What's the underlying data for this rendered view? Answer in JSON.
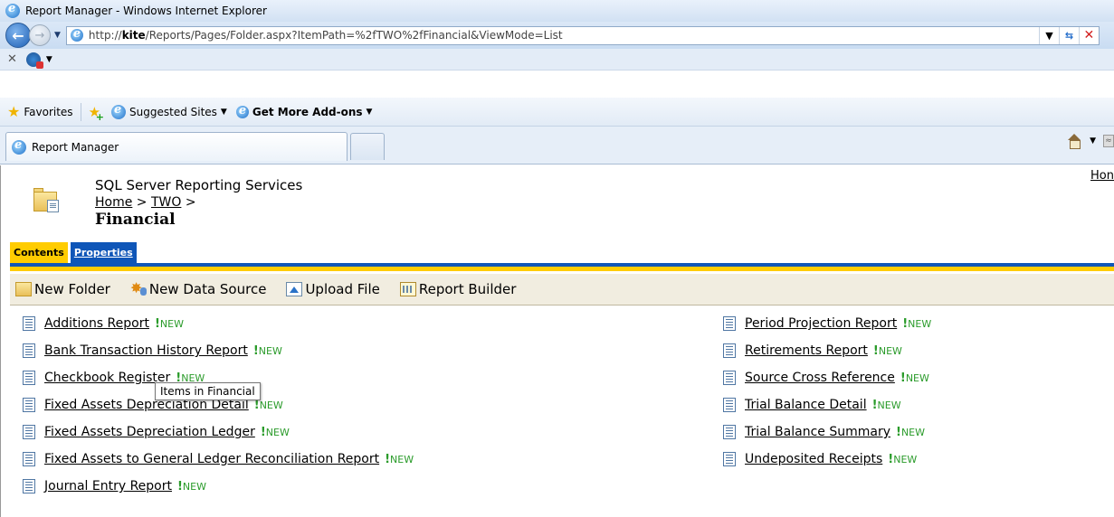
{
  "browser": {
    "window_title": "Report Manager - Windows Internet Explorer",
    "address": {
      "prefix": "http://",
      "host": "kite",
      "path": "/Reports/Pages/Folder.aspx?ItemPath=%2fTWO%2fFinancial&ViewMode=List"
    },
    "favorites": {
      "favorites_label": "Favorites",
      "suggested_sites_label": "Suggested Sites",
      "addons_label": "Get More Add-ons"
    },
    "tab_title": "Report Manager"
  },
  "page": {
    "app_title": "SQL Server Reporting Services",
    "breadcrumb": {
      "home": "Home",
      "sep1": ">",
      "two": "TWO",
      "sep2": ">"
    },
    "folder_name": "Financial",
    "home_link": "Hon",
    "tabs": {
      "contents": "Contents",
      "properties": "Properties"
    },
    "actions": {
      "new_folder": "New Folder",
      "new_data_source": "New Data Source",
      "upload_file": "Upload File",
      "report_builder": "Report Builder"
    },
    "badge": {
      "mark": "!",
      "text": "NEW"
    },
    "reports_left": [
      {
        "label": "Additions Report"
      },
      {
        "label": "Bank Transaction History Report"
      },
      {
        "label": "Checkbook Register"
      },
      {
        "label": "Fixed Assets Depreciation Detail"
      },
      {
        "label": "Fixed Assets Depreciation Ledger"
      },
      {
        "label": "Fixed Assets to General Ledger Reconciliation Report"
      },
      {
        "label": "Journal Entry Report"
      }
    ],
    "reports_right": [
      {
        "label": "Period Projection Report"
      },
      {
        "label": "Retirements Report"
      },
      {
        "label": "Source Cross Reference"
      },
      {
        "label": "Trial Balance Detail"
      },
      {
        "label": "Trial Balance Summary"
      },
      {
        "label": "Undeposited Receipts"
      }
    ],
    "tooltip": "Items in Financial"
  },
  "colors": {
    "tab_active": "#ffcc00",
    "tab_inactive": "#0f56b8",
    "new_badge": "#2a9b2a"
  }
}
